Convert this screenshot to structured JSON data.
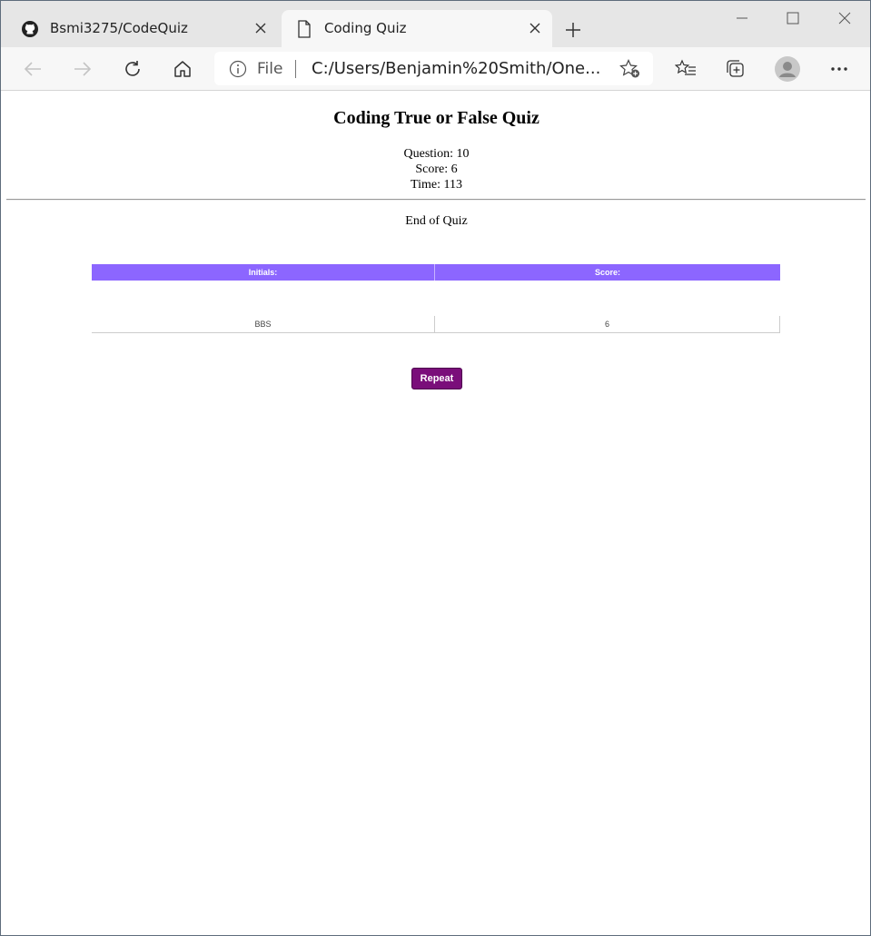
{
  "browser": {
    "tabs": [
      {
        "title": "Bsmi3275/CodeQuiz",
        "icon": "github-icon",
        "active": false
      },
      {
        "title": "Coding Quiz",
        "icon": "document-icon",
        "active": true
      }
    ],
    "address": {
      "scheme_label": "File",
      "url": "C:/Users/Benjamin%20Smith/One..."
    }
  },
  "page": {
    "title": "Coding True or False Quiz",
    "question_line": "Question: 10",
    "score_line": "Score: 6",
    "time_line": "Time: 113",
    "end_text": "End of Quiz",
    "table": {
      "headers": [
        "Initials:",
        "Score:"
      ],
      "rows": [
        {
          "initials": "BBS",
          "score": "6"
        }
      ]
    },
    "repeat_label": "Repeat"
  },
  "colors": {
    "table_header": "#8c66ff",
    "repeat_button": "#7a0e7a"
  }
}
